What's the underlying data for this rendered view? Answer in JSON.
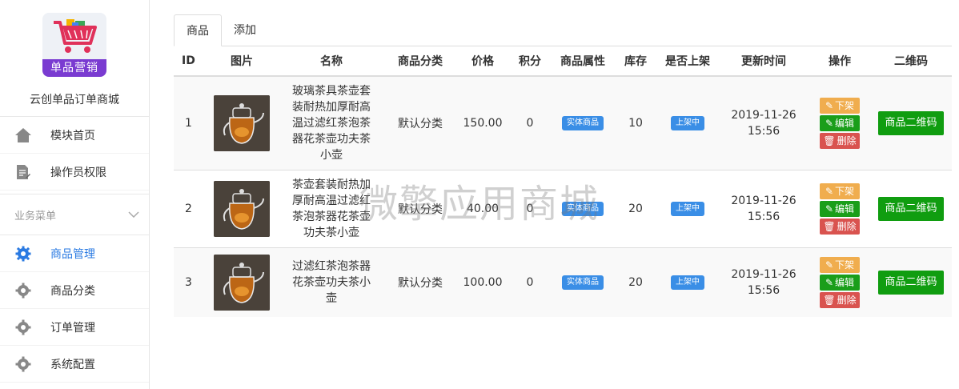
{
  "sidebar": {
    "logo_text": "单品营销",
    "shop_name": "云创单品订单商城",
    "top_items": [
      {
        "label": "模块首页",
        "icon": "home-icon"
      },
      {
        "label": "操作员权限",
        "icon": "edit-document-icon"
      }
    ],
    "group_label": "业务菜单",
    "group_items": [
      {
        "label": "商品管理",
        "icon": "gear-icon",
        "active": true
      },
      {
        "label": "商品分类",
        "icon": "gear-icon"
      },
      {
        "label": "订单管理",
        "icon": "gear-icon"
      },
      {
        "label": "系统配置",
        "icon": "gear-icon"
      }
    ]
  },
  "tabs": [
    "商品",
    "添加"
  ],
  "table": {
    "headers": [
      "ID",
      "图片",
      "名称",
      "商品分类",
      "价格",
      "积分",
      "商品属性",
      "库存",
      "是否上架",
      "更新时间",
      "操作",
      "二维码"
    ],
    "rows": [
      {
        "id": "1",
        "name": "玻璃茶具茶壶套装耐热加厚耐高温过滤红茶泡茶器花茶壶功夫茶小壶",
        "category": "默认分类",
        "price": "150.00",
        "points": "0",
        "attr": "实体商品",
        "stock": "10",
        "status": "上架中",
        "date": "2019-11-26",
        "time": "15:56"
      },
      {
        "id": "2",
        "name": "茶壶套装耐热加厚耐高温过滤红茶泡茶器花茶壶功夫茶小壶",
        "category": "默认分类",
        "price": "40.00",
        "points": "0",
        "attr": "实体商品",
        "stock": "20",
        "status": "上架中",
        "date": "2019-11-26",
        "time": "15:56"
      },
      {
        "id": "3",
        "name": "过滤红茶泡茶器花茶壶功夫茶小壶",
        "category": "默认分类",
        "price": "100.00",
        "points": "0",
        "attr": "实体商品",
        "stock": "20",
        "status": "上架中",
        "date": "2019-11-26",
        "time": "15:56"
      }
    ],
    "op_labels": {
      "off": "下架",
      "edit": "编辑",
      "delete": "删除"
    },
    "qr_label": "商品二维码"
  },
  "watermark": "微擎应用商城",
  "colors": {
    "accent": "#2a7ae2",
    "logo_band": "#7a3bd1",
    "warn": "#f0ad4e",
    "ok": "#1a9e1a",
    "danger": "#d9534f",
    "qr": "#109d10",
    "badge": "#3a8ee6"
  }
}
